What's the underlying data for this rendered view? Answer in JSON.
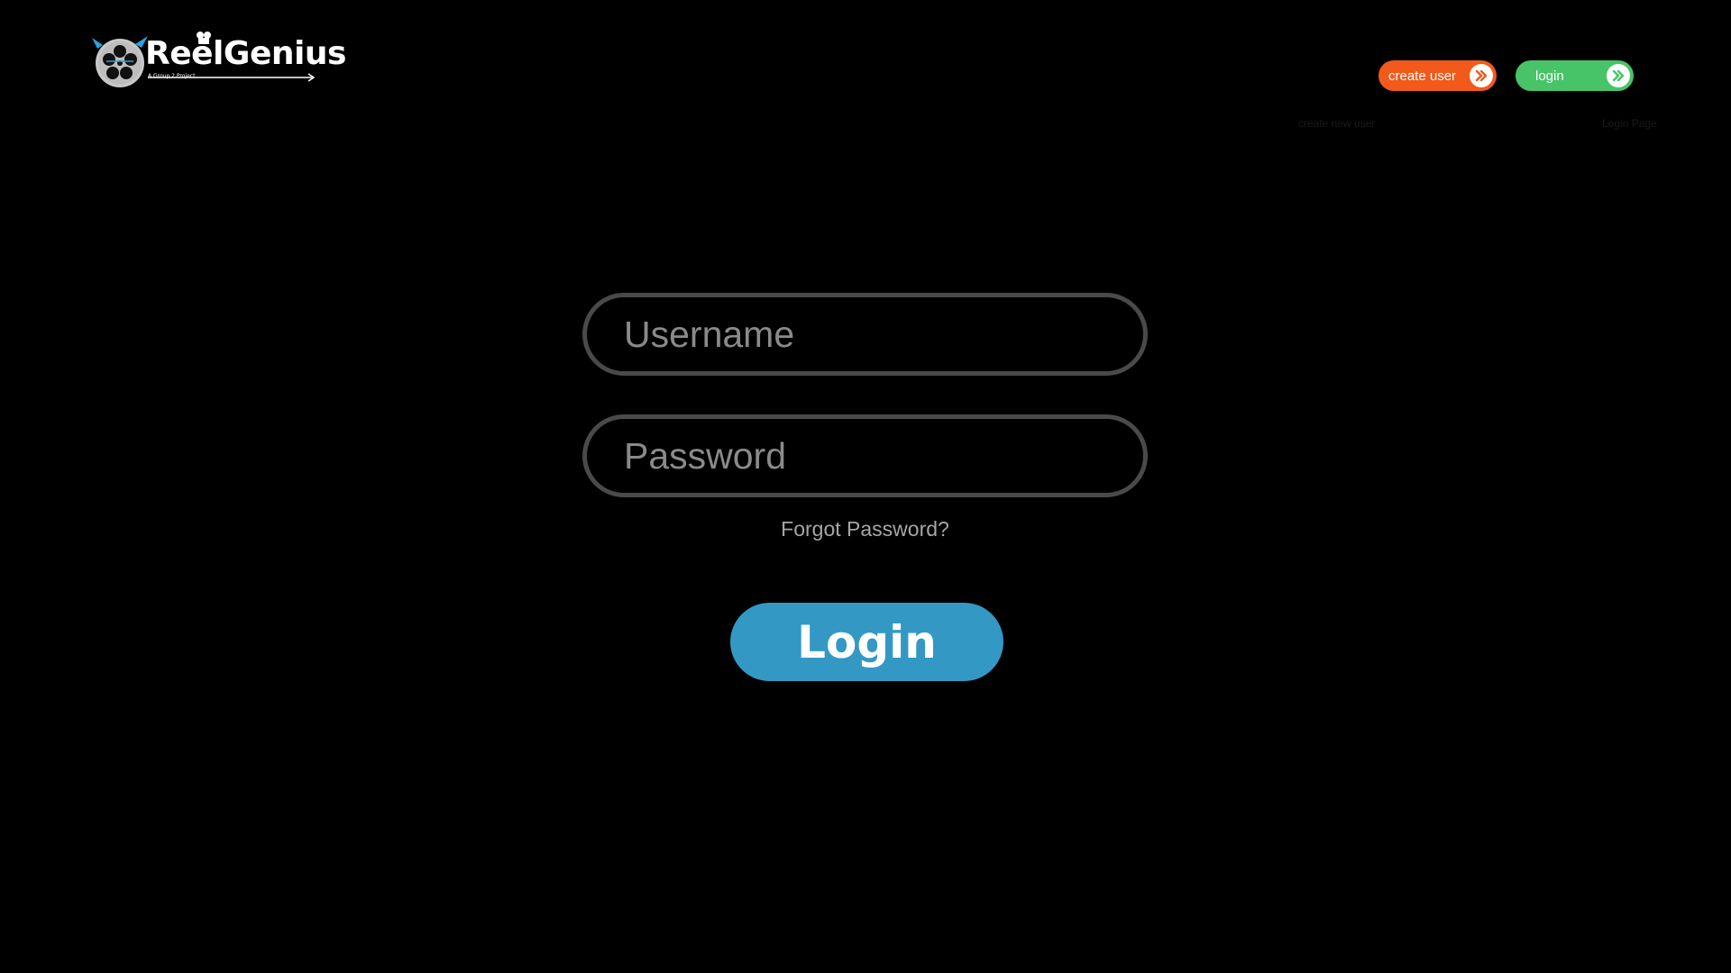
{
  "brand": {
    "name": "ReelGenius",
    "tagline": "A Group 2 Project",
    "logo_icon": "film-reel-icon",
    "accent_color": "#29a3e0"
  },
  "header": {
    "create_user": {
      "label": "create user",
      "icon": "double-chevron-right-icon",
      "color": "#f15a1a",
      "caption": "create new user"
    },
    "login": {
      "label": "login",
      "icon": "double-chevron-right-icon",
      "color": "#47c467",
      "caption": "Login Page"
    }
  },
  "form": {
    "username_placeholder": "Username",
    "username_value": "",
    "password_placeholder": "Password",
    "password_value": "",
    "forgot_label": "Forgot Password?",
    "submit_label": "Login",
    "submit_color": "#3399c4"
  }
}
